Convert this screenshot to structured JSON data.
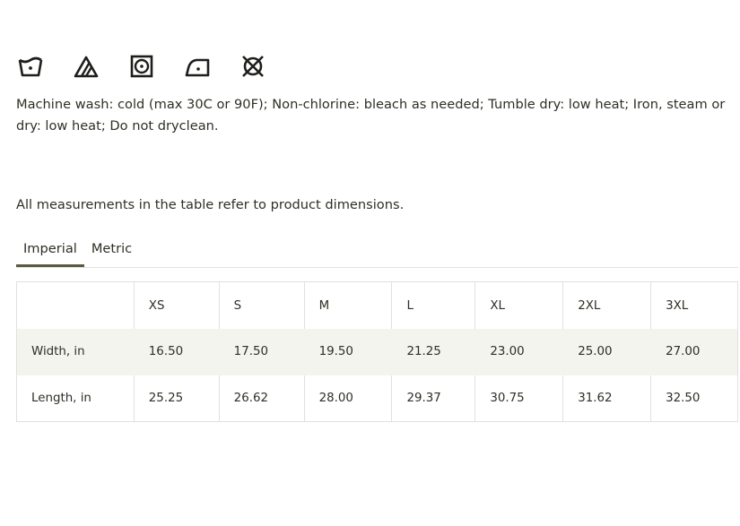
{
  "care": {
    "icons": [
      {
        "name": "machine-wash-cold-icon"
      },
      {
        "name": "non-chlorine-bleach-icon"
      },
      {
        "name": "tumble-dry-low-icon"
      },
      {
        "name": "iron-low-icon"
      },
      {
        "name": "do-not-dryclean-icon"
      }
    ],
    "instructions": "Machine wash: cold (max 30C or 90F); Non-chlorine: bleach as needed; Tumble dry: low heat; Iron, steam or dry: low heat; Do not dryclean."
  },
  "measurement_note": "All measurements in the table refer to product dimensions.",
  "tabs": {
    "imperial": "Imperial",
    "metric": "Metric",
    "active": "Imperial"
  },
  "table": {
    "corner": "",
    "sizes": [
      "XS",
      "S",
      "M",
      "L",
      "XL",
      "2XL",
      "3XL"
    ],
    "rows": [
      {
        "label": "Width, in",
        "values": [
          "16.50",
          "17.50",
          "19.50",
          "21.25",
          "23.00",
          "25.00",
          "27.00"
        ]
      },
      {
        "label": "Length, in",
        "values": [
          "25.25",
          "26.62",
          "28.00",
          "29.37",
          "30.75",
          "31.62",
          "32.50"
        ]
      }
    ]
  },
  "colors": {
    "text": "#2f2f25",
    "tab_active_underline": "#5b5a3f",
    "row_shade": "#f4f4ef",
    "border": "#e1e1dc"
  }
}
